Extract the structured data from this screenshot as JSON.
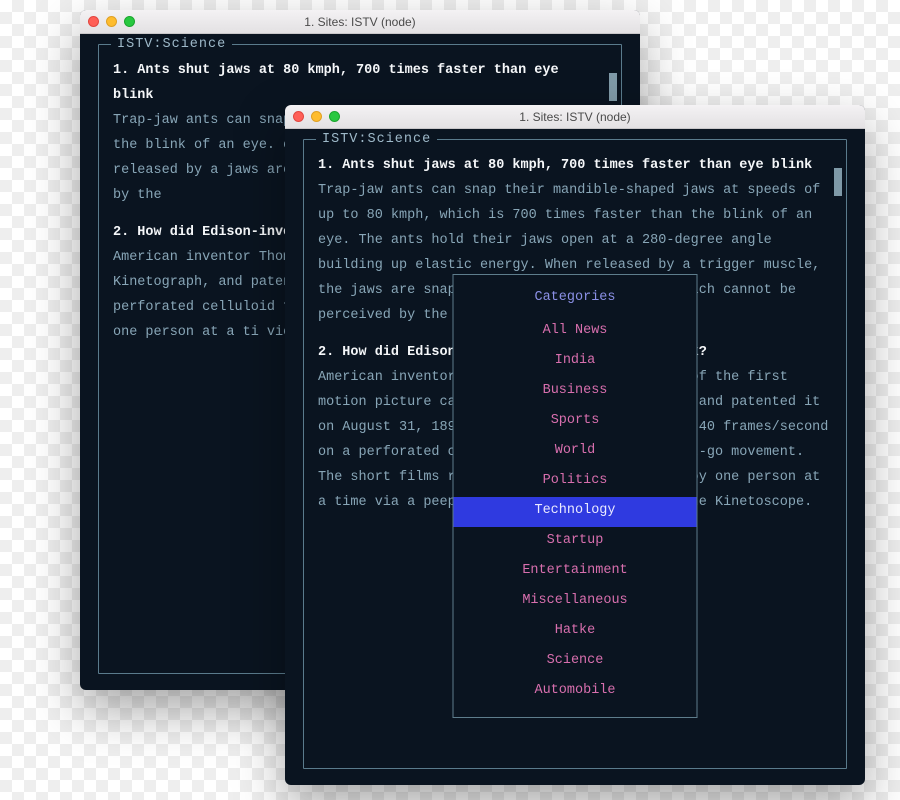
{
  "window_title": "1. Sites: ISTV (node)",
  "frame_label": "ISTV:Science",
  "stories_back": [
    {
      "headline": "1. Ants shut jaws at 80 kmph, 700 times faster than eye blink",
      "body": "Trap-jaw ants can snap the speeds of up to 80 kmph, w than the blink of an eye. open at a 280-degree angle energy. When released by a jaws are snapped in half a cannot be perceived by the"
    },
    {
      "headline": "2. How did Edison-invented Kinetograph work?",
      "body": "American inventor Thomas A the first motion picture c Kinetograph, and patented The camera captured around perforated celluloid film movement. The short films only by one person at a ti viewing cabinet called the"
    }
  ],
  "stories_front": [
    {
      "headline": "1. Ants shut jaws at 80 kmph, 700 times faster than eye blink",
      "body": "Trap-jaw ants can snap their mandible-shaped jaws at speeds of up to 80 kmph, which is 700 times faster than the blink of an eye. The ants hold their jaws open at a 280-degree angle building up elastic energy. When released by a trigger muscle, the jaws are snapped in half a millisecond, which cannot be perceived by the human eye."
    },
    {
      "headline": "2. How did Edison-invented the Kinetograph work?",
      "body": "American inventor Thomas Alva Edison made one of the first motion picture cameras, named the Kinetograph, and patented it on August 31, 1897. The camera captured around 40 frames/second on a perforated celluloid film using a stop-and-go movement. The short films recorded could be viewed only by one person at a time via a peephole viewing cabinet called the Kinetoscope."
    }
  ],
  "menu": {
    "title": "Categories",
    "selected_index": 6,
    "items": [
      "All News",
      "India",
      "Business",
      "Sports",
      "World",
      "Politics",
      "Technology",
      "Startup",
      "Entertainment",
      "Miscellaneous",
      "Hatke",
      "Science",
      "Automobile"
    ]
  }
}
